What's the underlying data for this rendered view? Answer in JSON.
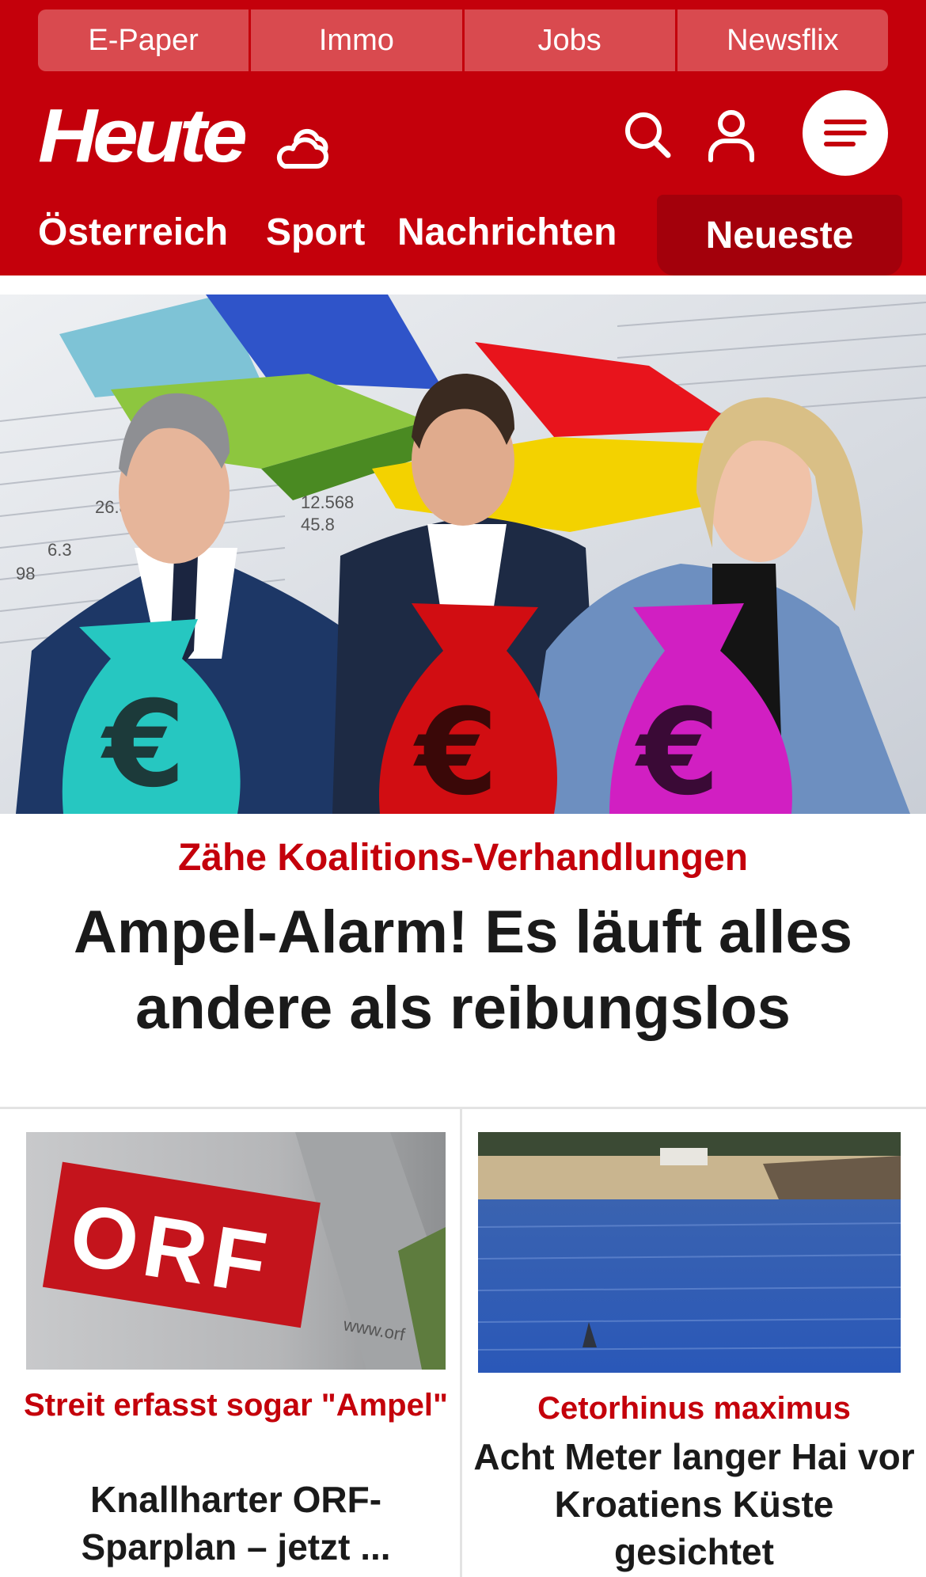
{
  "topbar": {
    "items": [
      "E-Paper",
      "Immo",
      "Jobs",
      "Newsflix"
    ]
  },
  "header": {
    "logo": "Heute",
    "icons": [
      "weather-icon",
      "search-icon",
      "user-icon",
      "menu-icon"
    ]
  },
  "nav": {
    "items": [
      "Österreich",
      "Sport",
      "Nachrichten"
    ],
    "active": "Neueste"
  },
  "hero": {
    "kicker": "Zähe Koalitions-Verhandlungen",
    "title": "Ampel-Alarm! Es läuft alles andere als reibungslos",
    "image_text": {
      "bag_symbol": "€",
      "table_numbers": [
        "12.568",
        "26.8",
        "45.8",
        "6.3",
        "98"
      ]
    }
  },
  "teasers": [
    {
      "kicker": "Streit erfasst sogar \"Ampel\"",
      "title": "Knallharter ORF-Sparplan – jetzt ...",
      "image_text": {
        "logo": "ORF",
        "url": "www.orf"
      }
    },
    {
      "kicker": "Cetorhinus maximus",
      "title": "Acht Meter langer Hai vor Kroatiens Küste gesichtet"
    }
  ],
  "colors": {
    "brand_red": "#c4000b",
    "topbar_tab": "#d94a4f",
    "nav_active": "#a3000b",
    "headline": "#1a1a1a"
  }
}
